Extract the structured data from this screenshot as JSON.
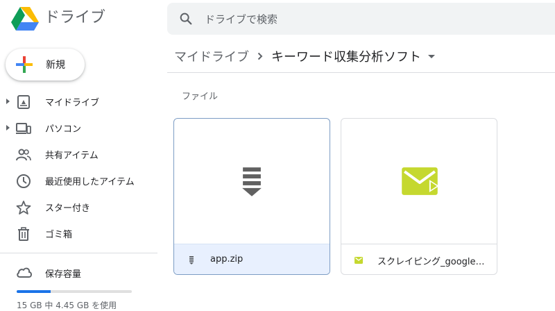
{
  "header": {
    "app_title": "ドライブ",
    "search_placeholder": "ドライブで検索"
  },
  "sidebar": {
    "new_label": "新規",
    "items": [
      {
        "label": "マイドライブ",
        "icon": "my-drive-icon",
        "expandable": true
      },
      {
        "label": "パソコン",
        "icon": "computers-icon",
        "expandable": true
      },
      {
        "label": "共有アイテム",
        "icon": "shared-people-icon",
        "expandable": false
      },
      {
        "label": "最近使用したアイテム",
        "icon": "clock-icon",
        "expandable": false
      },
      {
        "label": "スター付き",
        "icon": "star-icon",
        "expandable": false
      },
      {
        "label": "ゴミ箱",
        "icon": "trash-icon",
        "expandable": false
      }
    ],
    "storage": {
      "label": "保存容量",
      "usage_text": "15 GB 中 4.45 GB を使用",
      "used_fraction": 0.297
    }
  },
  "main": {
    "breadcrumb": {
      "root": "マイドライブ",
      "current": "キーワード収集分析ソフト"
    },
    "section_label": "ファイル",
    "files": [
      {
        "name": "app.zip",
        "type": "zip",
        "selected": true
      },
      {
        "name": "スクレイピング_google検...",
        "type": "email",
        "selected": false
      }
    ]
  },
  "colors": {
    "accent": "#1a73e8",
    "selected_bg": "#e8f0fe",
    "email_green": "#c5d82f"
  }
}
